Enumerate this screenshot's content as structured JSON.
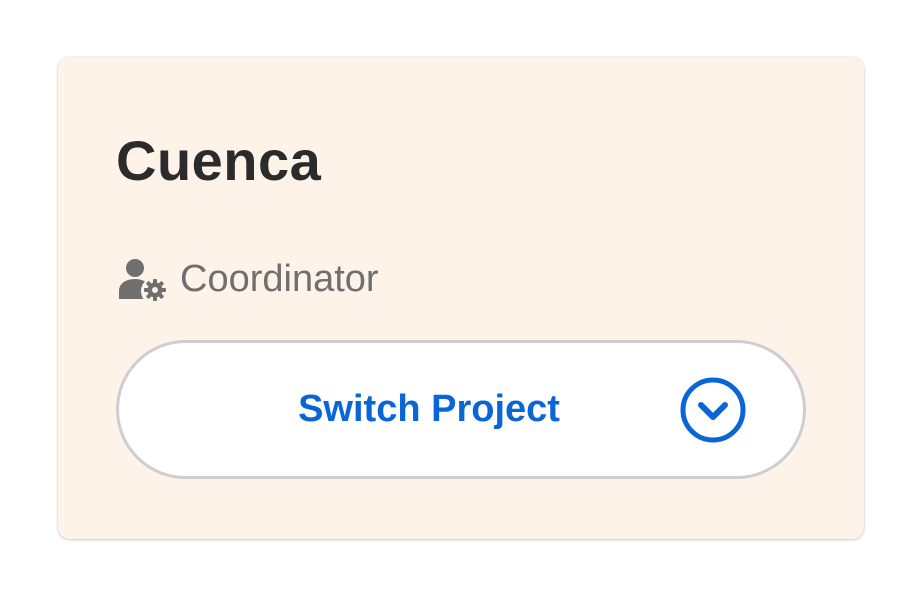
{
  "project": {
    "name": "Cuenca"
  },
  "role": {
    "label": "Coordinator",
    "icon": "user-gear-icon"
  },
  "switch_button": {
    "label": "Switch Project",
    "icon": "chevron-down-circle-icon"
  },
  "colors": {
    "card_background": "#fdf3e9",
    "accent": "#0a66d6",
    "title_text": "#2b2b2b",
    "secondary_text": "#6f6f6f",
    "button_border": "#cfcdd2"
  }
}
